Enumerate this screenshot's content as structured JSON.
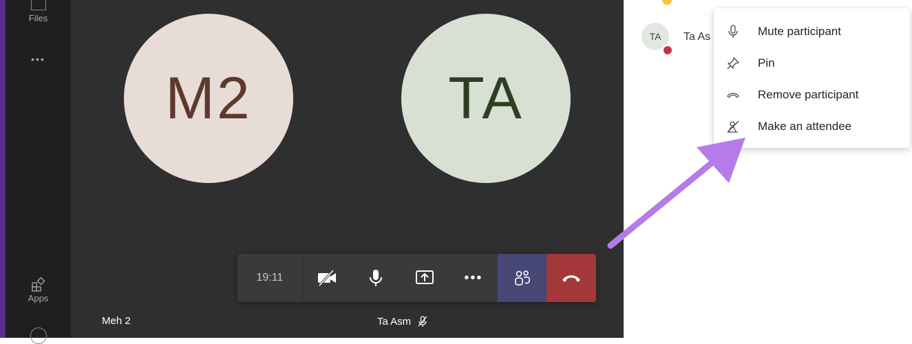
{
  "rail": {
    "files_label": "Files",
    "more_label": "•••",
    "apps_label": "Apps"
  },
  "stage": {
    "tiles": [
      {
        "initials": "M2",
        "name": "Meh 2"
      },
      {
        "initials": "TA",
        "name": "Ta Asm"
      }
    ]
  },
  "callbar": {
    "timer": "19:11",
    "more_label": "•••"
  },
  "panel": {
    "participant_initials": "TA",
    "participant_name": "Ta As"
  },
  "context_menu": {
    "items": [
      {
        "label": "Mute participant",
        "icon": "microphone-icon"
      },
      {
        "label": "Pin",
        "icon": "pin-icon"
      },
      {
        "label": "Remove participant",
        "icon": "hang-up-icon"
      },
      {
        "label": "Make an attendee",
        "icon": "make-attendee-icon"
      }
    ]
  },
  "colors": {
    "rail_bg": "#1f1f1f",
    "stage_bg": "#2d2c2c",
    "people_button": "#464775",
    "hangup_button": "#a4373a",
    "annotation_arrow": "#b57be8"
  }
}
